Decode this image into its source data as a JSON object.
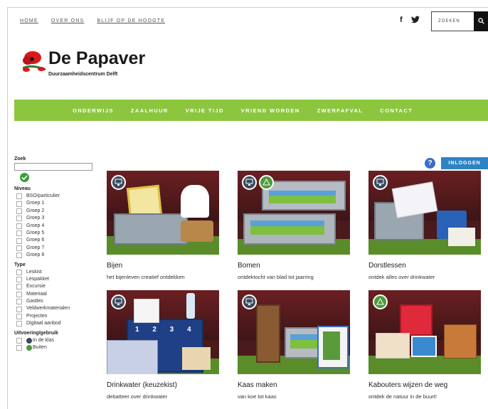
{
  "top_nav": [
    "HOME",
    "OVER ONS",
    "BLIJF OP DE HOOGTE"
  ],
  "social": {
    "facebook": "f",
    "twitter_icon": "twitter-icon"
  },
  "search": {
    "label": "ZOEKEN",
    "icon": "search-icon"
  },
  "logo": {
    "title": "De Papaver",
    "subtitle": "Duurzaamheidscentrum Delft"
  },
  "main_nav": [
    "ONDERWIJS",
    "ZAALHUUR",
    "VRIJE TIJD",
    "VRIEND WORDEN",
    "ZWERFAFVAL",
    "CONTACT"
  ],
  "sidebar": {
    "search_heading": "Zoek",
    "niveau_heading": "Niveau",
    "niveau": [
      "BSO/particulier",
      "Groep 1",
      "Groep 2",
      "Groep 3",
      "Groep 4",
      "Groep 5",
      "Groep 6",
      "Groep 7",
      "Groep 8"
    ],
    "type_heading": "Type",
    "type": [
      "Leskist",
      "Lespakket",
      "Excursie",
      "Materiaal",
      "Gastles",
      "Veldwerkmaterialen",
      "Projecten",
      "Digitaal aanbod"
    ],
    "uitvoering_heading": "Uitvoering/gebruik",
    "uitvoering": [
      "In de klas",
      "Buiten"
    ]
  },
  "help_label": "?",
  "login_label": "INLOGGEN",
  "cards": [
    {
      "title": "Bijen",
      "desc": "het bijenleven creatief ontdekken"
    },
    {
      "title": "Bomen",
      "desc": "ontdektocht van blad tot jaarring"
    },
    {
      "title": "Dorstlessen",
      "desc": "ontdek alles over drinkwater"
    },
    {
      "title": "Drinkwater (keuzekist)",
      "desc": "debatteer over drinkwater"
    },
    {
      "title": "Kaas maken",
      "desc": "van koe tot kaas"
    },
    {
      "title": "Kabouters wijzen de weg",
      "desc": "ontdek de natuur in de buurt!"
    }
  ],
  "colors": {
    "green_bar": "#8cc63f",
    "login": "#2f83c5",
    "help": "#3a6fc4",
    "accent_green": "#3aa03a"
  }
}
